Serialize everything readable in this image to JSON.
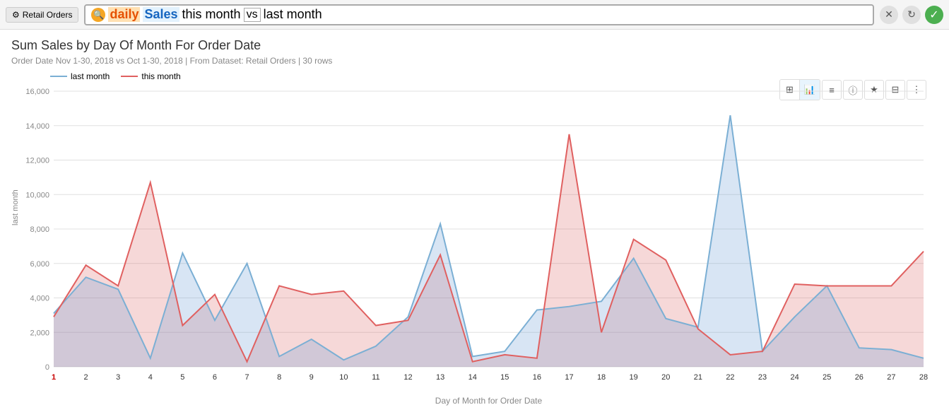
{
  "header": {
    "retail_orders_label": "Retail Orders",
    "search_text_daily": "daily",
    "search_text_sales": "Sales",
    "search_text_this_month": "this month",
    "search_text_vs": "vs",
    "search_text_last_month": "last month"
  },
  "toolbar": {
    "table_icon": "⊞",
    "bar_icon": "▐",
    "list_icon": "≡",
    "info_icon": "ⓘ",
    "star_icon": "★",
    "save_icon": "⊟",
    "more_icon": "⋮"
  },
  "chart": {
    "title": "Sum Sales by Day Of Month For Order Date",
    "subtitle": "Order Date Nov 1-30, 2018 vs Oct 1-30, 2018 | From Dataset: Retail Orders | 30 rows",
    "legend_last_month": "last month",
    "legend_this_month": "this month",
    "y_axis_label": "last month",
    "x_axis_label": "Day of Month for Order Date",
    "y_ticks": [
      "0",
      "2000",
      "4000",
      "6000",
      "8000",
      "10000",
      "12000",
      "14000",
      "16000"
    ],
    "x_ticks": [
      "1",
      "2",
      "3",
      "4",
      "5",
      "6",
      "7",
      "8",
      "9",
      "10",
      "11",
      "12",
      "13",
      "14",
      "15",
      "16",
      "17",
      "18",
      "19",
      "20",
      "21",
      "22",
      "23",
      "24",
      "25",
      "26",
      "27",
      "28"
    ],
    "last_month_data": [
      3100,
      5200,
      4500,
      500,
      6600,
      2700,
      6000,
      600,
      1600,
      400,
      1200,
      2900,
      8300,
      600,
      900,
      3300,
      3500,
      3800,
      6300,
      2800,
      2300,
      14600,
      900,
      2900,
      4700,
      1100,
      1000,
      500
    ],
    "this_month_data": [
      2900,
      5900,
      4700,
      10700,
      2400,
      4200,
      300,
      4700,
      4200,
      4400,
      2400,
      2700,
      6500,
      300,
      700,
      500,
      13500,
      2000,
      7400,
      6200,
      2200,
      700,
      900,
      4800,
      4700,
      4700,
      4700,
      6700
    ]
  }
}
